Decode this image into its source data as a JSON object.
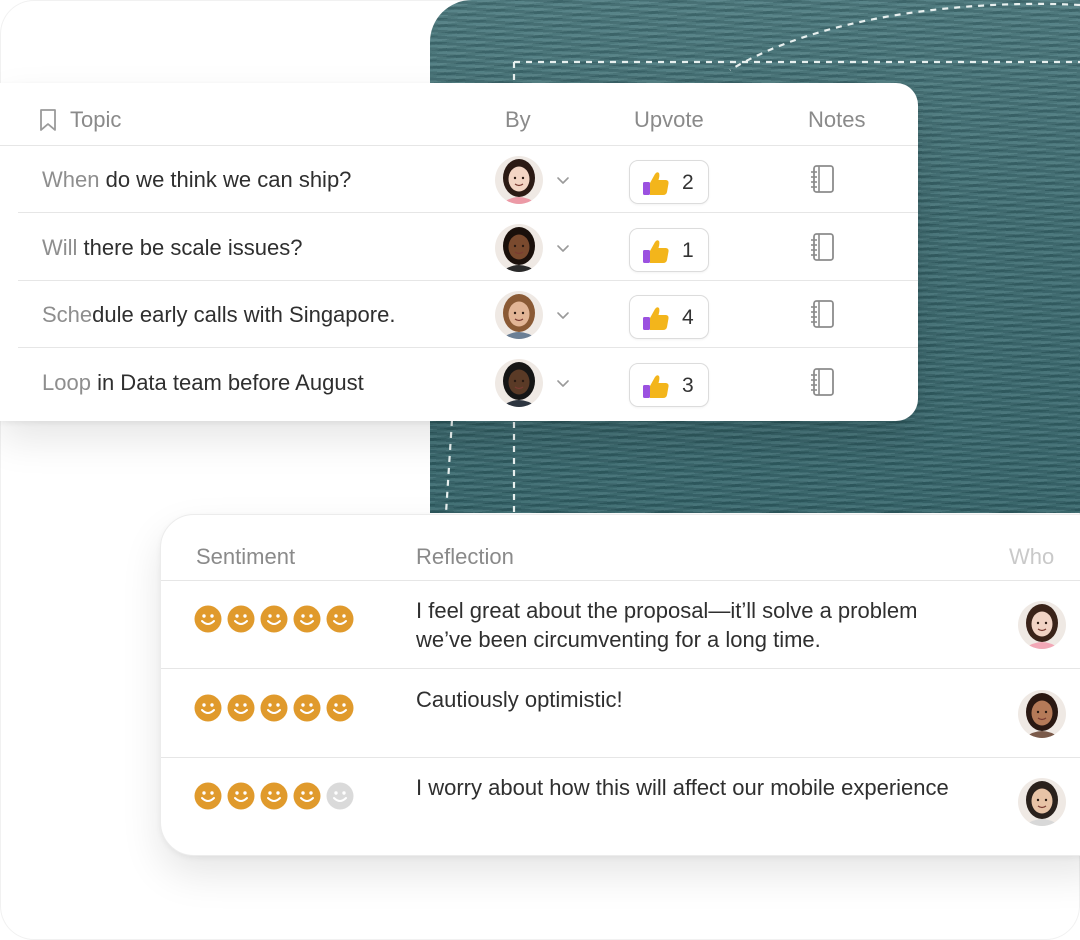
{
  "topic_table": {
    "headers": {
      "topic": "Topic",
      "by": "By",
      "upvote": "Upvote",
      "notes": "Notes"
    },
    "rows": [
      {
        "soft": "When",
        "rest": " do we think we can ship?",
        "votes": "2",
        "avatar": "person-1"
      },
      {
        "soft": "Will",
        "rest": " there be scale issues?",
        "votes": "1",
        "avatar": "person-2"
      },
      {
        "soft": "Sche",
        "rest": "dule early calls with Singapore.",
        "votes": "4",
        "avatar": "person-3"
      },
      {
        "soft": "Loop",
        "rest": " in Data team before August",
        "votes": "3",
        "avatar": "person-4"
      }
    ],
    "vote_icon": "thumbs-up-icon",
    "notes_icon": "notebook-icon",
    "header_icon": "bookmark-icon"
  },
  "sentiment_table": {
    "headers": {
      "sentiment": "Sentiment",
      "reflection": "Reflection",
      "who": "Who"
    },
    "rows": [
      {
        "rating": 5,
        "reflection": "I feel great about the proposal—it’ll solve a problem we’ve been circumventing for a long time.",
        "avatar": "person-5"
      },
      {
        "rating": 5,
        "reflection": "Cautiously optimistic!",
        "avatar": "person-6"
      },
      {
        "rating": 4,
        "reflection": "I worry about how this will affect our mobile experience",
        "avatar": "person-7"
      }
    ],
    "max_rating": 5,
    "face_icon": "smiley-face-icon"
  },
  "colors": {
    "face_active": "#e09a2c",
    "face_inactive": "#dadada",
    "water": "#3f6d72",
    "thumb": "#f3b51b",
    "cuff": "#9b51e0"
  }
}
